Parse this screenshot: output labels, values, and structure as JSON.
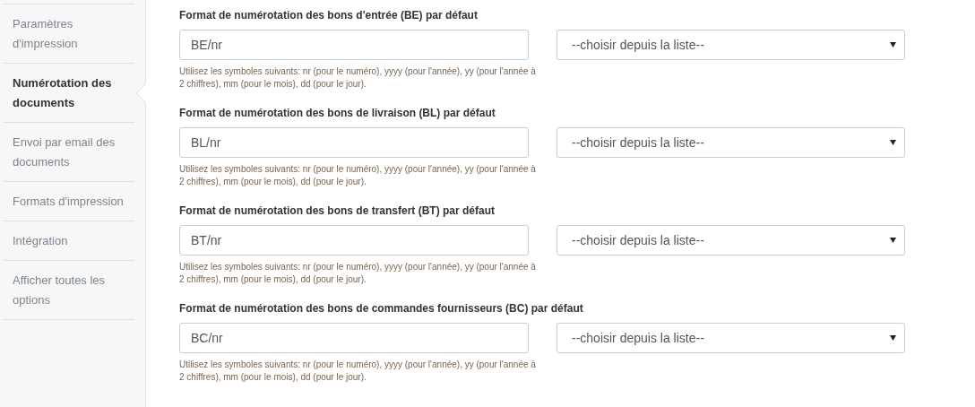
{
  "sidebar": {
    "items": [
      {
        "label": "Paramètres d'impression",
        "selected": false
      },
      {
        "label": "Numérotation des documents",
        "selected": true
      },
      {
        "label": "Envoi par email des documents",
        "selected": false
      },
      {
        "label": "Formats d'impression",
        "selected": false
      },
      {
        "label": "Intégration",
        "selected": false
      },
      {
        "label": "Afficher toutes les options",
        "selected": false
      }
    ]
  },
  "sections": [
    {
      "title": "Format de numérotation des bons d'entrée (BE) par défaut",
      "value": "BE/nr",
      "select": "--choisir depuis la liste--",
      "help": "Utilisez les symboles suivants: nr (pour le numéro), yyyy (pour l'année), yy (pour l'année à 2 chiffres), mm (pour le mois), dd (pour le jour)."
    },
    {
      "title": "Format de numérotation des bons de livraison (BL) par défaut",
      "value": "BL/nr",
      "select": "--choisir depuis la liste--",
      "help": "Utilisez les symboles suivants: nr (pour le numéro), yyyy (pour l'année), yy (pour l'année à 2 chiffres), mm (pour le mois), dd (pour le jour)."
    },
    {
      "title": "Format de numérotation des bons de transfert (BT) par défaut",
      "value": "BT/nr",
      "select": "--choisir depuis la liste--",
      "help": "Utilisez les symboles suivants: nr (pour le numéro), yyyy (pour l'année), yy (pour l'année à 2 chiffres), mm (pour le mois), dd (pour le jour)."
    },
    {
      "title": "Format de numérotation des bons de commandes fournisseurs (BC) par défaut",
      "value": "BC/nr",
      "select": "--choisir depuis la liste--",
      "help": "Utilisez les symboles suivants: nr (pour le numéro), yyyy (pour l'année), yy (pour l'année à 2 chiffres), mm (pour le mois), dd (pour le jour)."
    }
  ]
}
